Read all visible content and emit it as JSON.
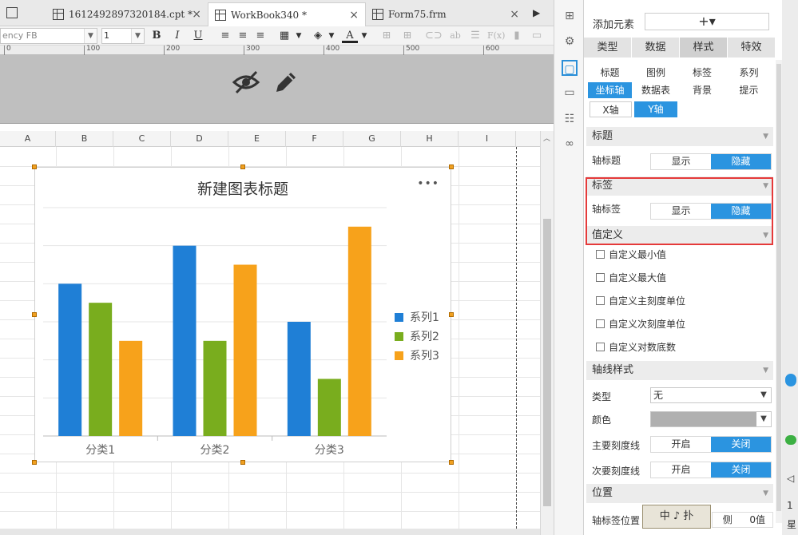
{
  "tabs": [
    {
      "label": "1612492897320184.cpt *",
      "close": "×"
    },
    {
      "label": "WorkBook340 *",
      "close": "×"
    },
    {
      "label": "Form75.frm",
      "close": "×"
    }
  ],
  "toolbar": {
    "font_name": "ency FB",
    "font_size": "1",
    "bold": "B",
    "italic": "I",
    "underline": "U",
    "text_color_glyph": "A"
  },
  "ruler": {
    "ticks": [
      "0",
      "100",
      "200",
      "300",
      "400",
      "500",
      "600"
    ]
  },
  "columns": [
    "A",
    "B",
    "C",
    "D",
    "E",
    "F",
    "G",
    "H",
    "I"
  ],
  "chart_data": {
    "type": "bar",
    "title": "新建图表标题",
    "categories": [
      "分类1",
      "分类2",
      "分类3"
    ],
    "series": [
      {
        "name": "系列1",
        "color": "#1f7fd6",
        "values": [
          80,
          100,
          60
        ]
      },
      {
        "name": "系列2",
        "color": "#79ad1e",
        "values": [
          70,
          50,
          30
        ]
      },
      {
        "name": "系列3",
        "color": "#f7a21b",
        "values": [
          50,
          90,
          110
        ]
      }
    ],
    "ylim": [
      0,
      120
    ],
    "legend_position": "right",
    "axes_visible": false,
    "grid": true
  },
  "chart_menu": "•••",
  "panel": {
    "add_label": "添加元素",
    "add_glyph": "+▾",
    "main_tabs": [
      "类型",
      "数据",
      "样式",
      "特效"
    ],
    "sub_tabs": [
      [
        "标题",
        "图例",
        "标签",
        "系列"
      ],
      [
        "坐标轴",
        "数据表",
        "背景",
        "提示"
      ]
    ],
    "axis_tabs": [
      "X轴",
      "Y轴"
    ],
    "section_title": "标题",
    "axis_title_label": "轴标题",
    "section_label": "标签",
    "axis_label_label": "轴标签",
    "section_value": "值定义",
    "show": "显示",
    "hide": "隐藏",
    "checks": [
      "自定义最小值",
      "自定义最大值",
      "自定义主刻度单位",
      "自定义次刻度单位",
      "自定义对数底数"
    ],
    "section_axisline": "轴线样式",
    "type_label": "类型",
    "type_value": "无",
    "color_label": "颜色",
    "major_tick_label": "主要刻度线",
    "minor_tick_label": "次要刻度线",
    "on": "开启",
    "off": "关闭",
    "section_position": "位置",
    "label_pos_label": "轴标签位置",
    "label_pos_ime": "中 ♪ 扑",
    "label_pos_side": "侧",
    "label_pos_value": "0值"
  },
  "edge_glyphs": [
    "1",
    "星"
  ]
}
